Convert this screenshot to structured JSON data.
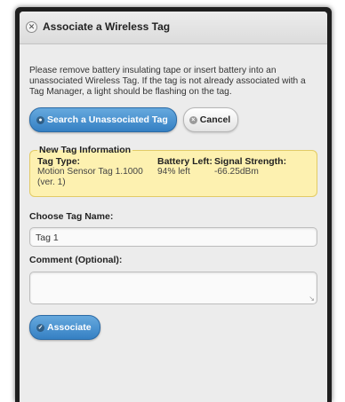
{
  "dialog": {
    "title": "Associate a Wireless Tag",
    "close_glyph": "✕",
    "instructions": "Please remove battery insulating tape or insert battery into an unassociated Wireless Tag. If the tag is not already associated with a Tag Manager, a light should be flashing on the tag."
  },
  "buttons": {
    "search_label": "Search a Unassociated Tag",
    "search_icon": "search-icon",
    "cancel_label": "Cancel",
    "cancel_icon": "close-icon",
    "associate_label": "Associate",
    "associate_icon": "check-icon"
  },
  "tag_info": {
    "legend": "New Tag Information",
    "type_heading": "Tag Type:",
    "type_value": "Motion Sensor Tag 1.1000 (ver. 1)",
    "battery_heading": "Battery Left:",
    "battery_value": "94% left",
    "signal_heading": "Signal Strength:",
    "signal_value": "-66.25dBm"
  },
  "form": {
    "name_label": "Choose Tag Name:",
    "name_value": "Tag 1",
    "comment_label": "Comment (Optional):",
    "comment_value": ""
  },
  "colors": {
    "primary_button": "#3580c3",
    "info_background": "#fdf1b0",
    "dialog_frame": "#1f1f1f"
  }
}
